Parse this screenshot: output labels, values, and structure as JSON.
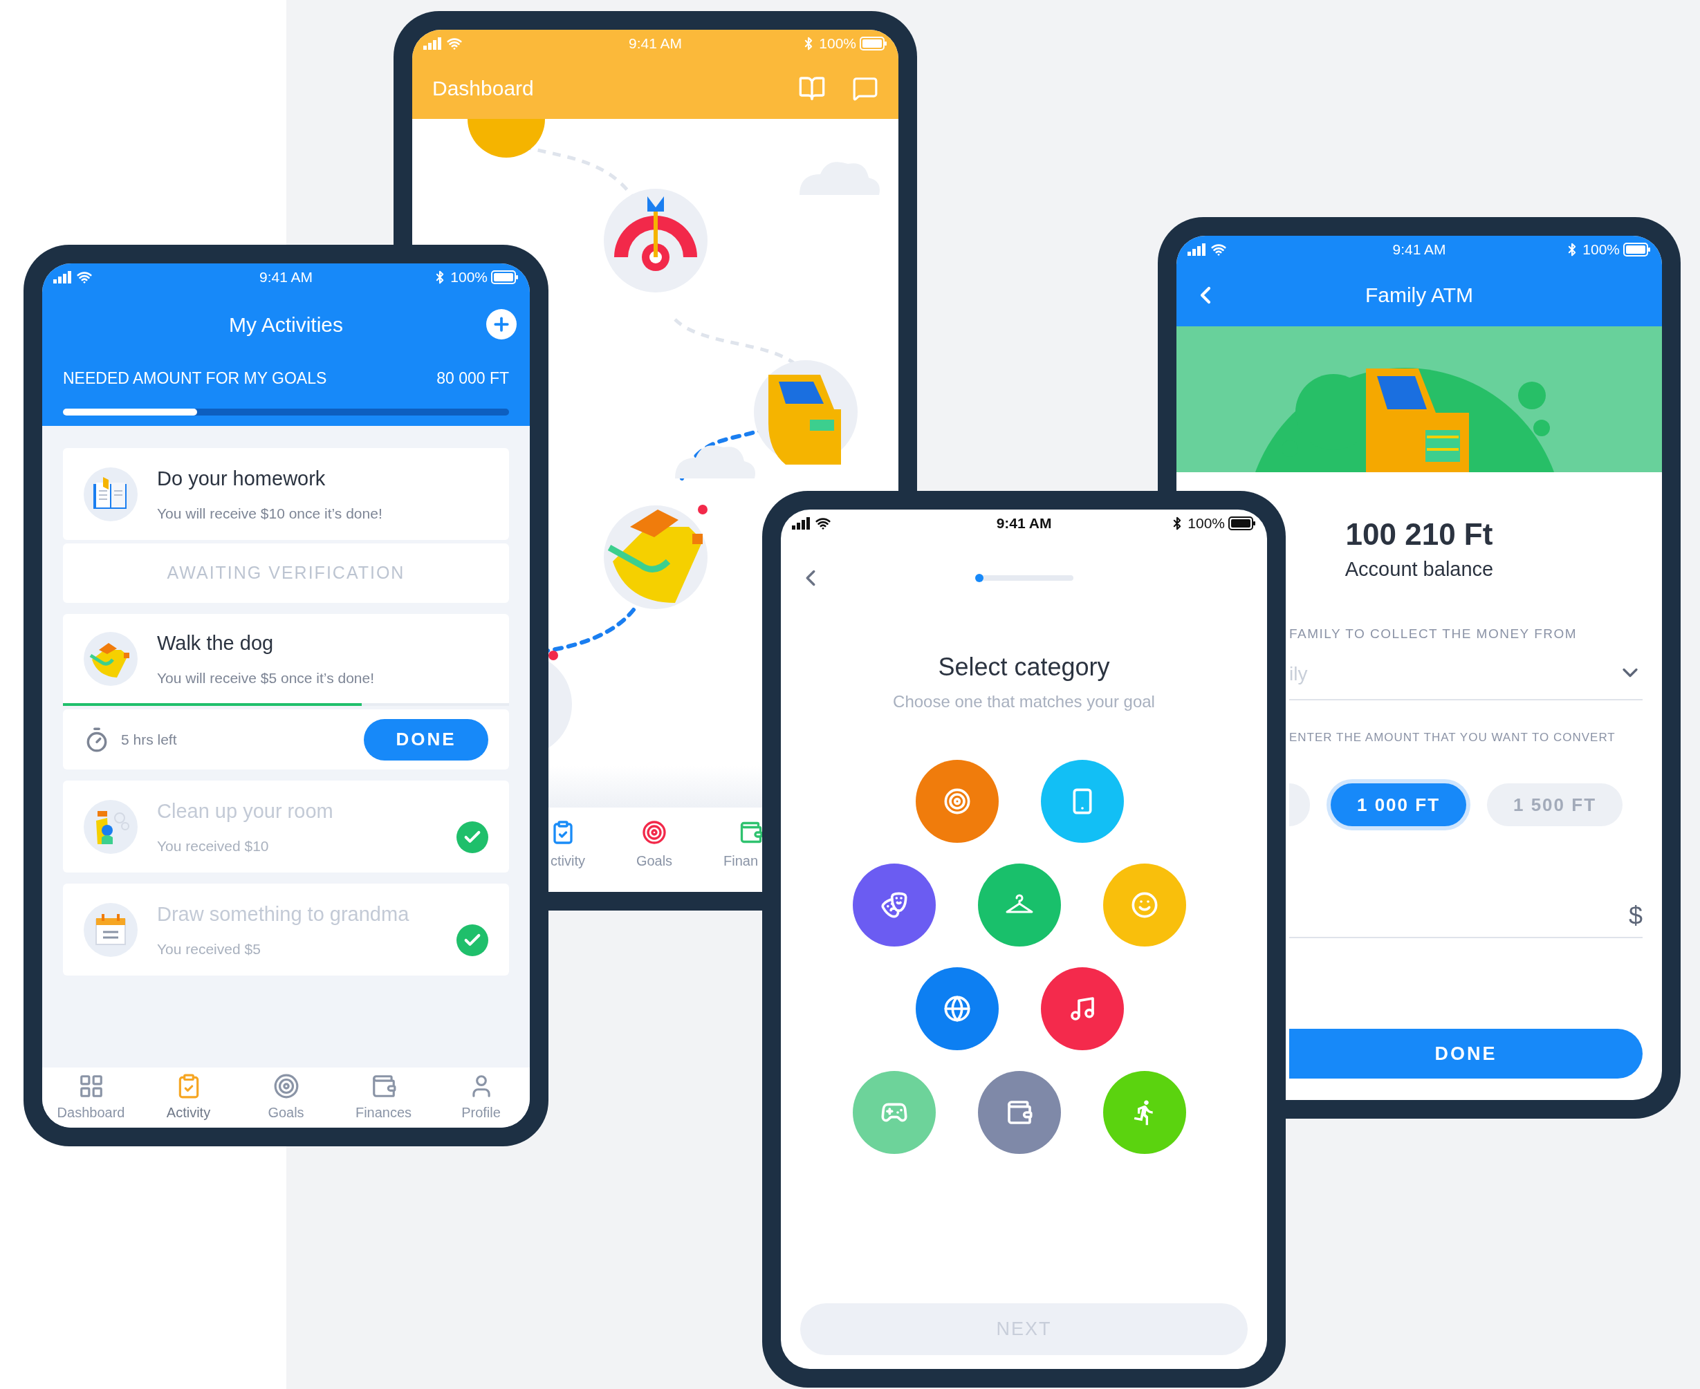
{
  "dashboard_phone": {
    "status_bar": {
      "time": "9:41 AM",
      "battery": "100%"
    },
    "title": "Dashboard",
    "tab_bar": [
      {
        "label": "ctivity",
        "kind": "activity"
      },
      {
        "label": "Goals",
        "kind": "goals"
      },
      {
        "label": "Finan",
        "kind": "finances"
      }
    ]
  },
  "activities_phone": {
    "status_bar": {
      "time": "9:41 AM",
      "battery": "100%"
    },
    "title": "My Activities",
    "goal_summary": {
      "label": "NEEDED AMOUNT FOR MY GOALS",
      "amount": "80 000 FT",
      "level": 0.3
    },
    "tasks": [
      {
        "kind": "homework",
        "title": "Do your homework",
        "subtitle": "You will receive $10 once it’s done!",
        "completed": false,
        "status": "AWAITING VERIFICATION"
      },
      {
        "kind": "dog",
        "title": "Walk the dog",
        "subtitle": "You will receive $5 once it’s done!",
        "completed": false,
        "level": 0.67,
        "time_left": "5 hrs left",
        "action": "DONE"
      },
      {
        "kind": "room",
        "title": "Clean up your room",
        "subtitle": "You received $10",
        "completed": true
      },
      {
        "kind": "calendar",
        "title": "Draw something to grandma",
        "subtitle": "You received $5",
        "completed": true
      }
    ],
    "tab_bar": [
      {
        "label": "Dashboard",
        "kind": "dashboard",
        "selected": false
      },
      {
        "label": "Activity",
        "kind": "activity",
        "selected": true
      },
      {
        "label": "Goals",
        "kind": "goals",
        "selected": false
      },
      {
        "label": "Finances",
        "kind": "finances",
        "selected": false
      },
      {
        "label": "Profile",
        "kind": "profile",
        "selected": false
      }
    ]
  },
  "atm_phone": {
    "status_bar": {
      "time": "9:41 AM",
      "battery": "100%"
    },
    "title": "Family ATM",
    "balance": "100 210 Ft",
    "balance_label": "Account balance",
    "family_field": {
      "label": "FAMILY TO COLLECT THE MONEY FROM",
      "value": "ily"
    },
    "amount_label": "ENTER THE AMOUNT THAT YOU WANT TO CONVERT",
    "amounts": [
      {
        "selected": false
      },
      {
        "label": "1 000 FT",
        "selected": true
      },
      {
        "label": "1 500 FT",
        "selected": false
      }
    ],
    "currency": "$",
    "button": "DONE"
  },
  "category_phone": {
    "status_bar": {
      "time": "9:41 AM",
      "battery": "100%"
    },
    "title": "Select category",
    "subtitle": "Choose one that matches your goal",
    "category_rows": [
      {
        "items": [
          {
            "kind": "target",
            "color": "#f07c0c"
          },
          {
            "kind": "phone",
            "color": "#12bff5"
          }
        ]
      },
      {
        "items": [
          {
            "kind": "masks",
            "color": "#6b5cf2"
          },
          {
            "kind": "hanger",
            "color": "#19c06b"
          },
          {
            "kind": "smile",
            "color": "#f9bf0c"
          }
        ]
      },
      {
        "items": [
          {
            "kind": "globe",
            "color": "#0d7ff2"
          },
          {
            "kind": "music",
            "color": "#f42a4c"
          }
        ]
      },
      {
        "items": [
          {
            "kind": "gamepad",
            "color": "#6dd39a"
          },
          {
            "kind": "wallet",
            "color": "#7f89a8"
          },
          {
            "kind": "running",
            "color": "#5bd30f"
          }
        ]
      }
    ],
    "next_button": {
      "label": "NEXT",
      "disabled": true
    }
  }
}
